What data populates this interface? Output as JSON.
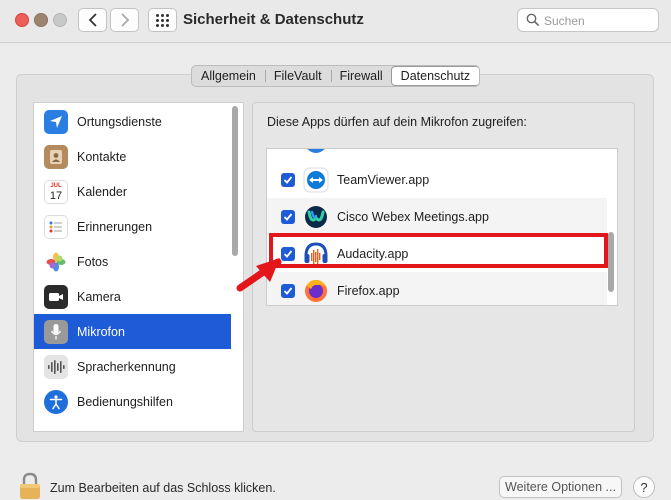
{
  "window": {
    "title": "Sicherheit & Datenschutz"
  },
  "search": {
    "placeholder": "Suchen"
  },
  "tabs": [
    {
      "label": "Allgemein",
      "active": false
    },
    {
      "label": "FileVault",
      "active": false
    },
    {
      "label": "Firewall",
      "active": false
    },
    {
      "label": "Datenschutz",
      "active": true
    }
  ],
  "sidebar": {
    "items": [
      {
        "label": "Ortungsdienste",
        "icon": "location-arrow-icon",
        "selected": false
      },
      {
        "label": "Kontakte",
        "icon": "contacts-icon",
        "selected": false
      },
      {
        "label": "Kalender",
        "icon": "calendar-icon",
        "calendar_month": "JUL",
        "calendar_day": "17",
        "selected": false
      },
      {
        "label": "Erinnerungen",
        "icon": "reminders-icon",
        "selected": false
      },
      {
        "label": "Fotos",
        "icon": "photos-icon",
        "selected": false
      },
      {
        "label": "Kamera",
        "icon": "camera-icon",
        "selected": false
      },
      {
        "label": "Mikrofon",
        "icon": "microphone-icon",
        "selected": true
      },
      {
        "label": "Spracherkennung",
        "icon": "speech-recognition-icon",
        "selected": false
      },
      {
        "label": "Bedienungshilfen",
        "icon": "accessibility-icon",
        "selected": false
      }
    ]
  },
  "right_pane": {
    "heading": "Diese Apps dürfen auf dein Mikrofon zugreifen:",
    "apps": [
      {
        "name": "TeamViewer.app",
        "checked": true,
        "icon": "teamviewer-icon"
      },
      {
        "name": "Cisco Webex Meetings.app",
        "checked": true,
        "icon": "webex-icon"
      },
      {
        "name": "Audacity.app",
        "checked": true,
        "icon": "audacity-icon",
        "highlighted": true
      },
      {
        "name": "Firefox.app",
        "checked": true,
        "icon": "firefox-icon"
      }
    ]
  },
  "footer": {
    "lock_text": "Zum Bearbeiten auf das Schloss klicken.",
    "more_options_label": "Weitere Optionen ...",
    "help_label": "?"
  },
  "colors": {
    "accent": "#1e5bd6",
    "highlight": "#e3161b"
  }
}
